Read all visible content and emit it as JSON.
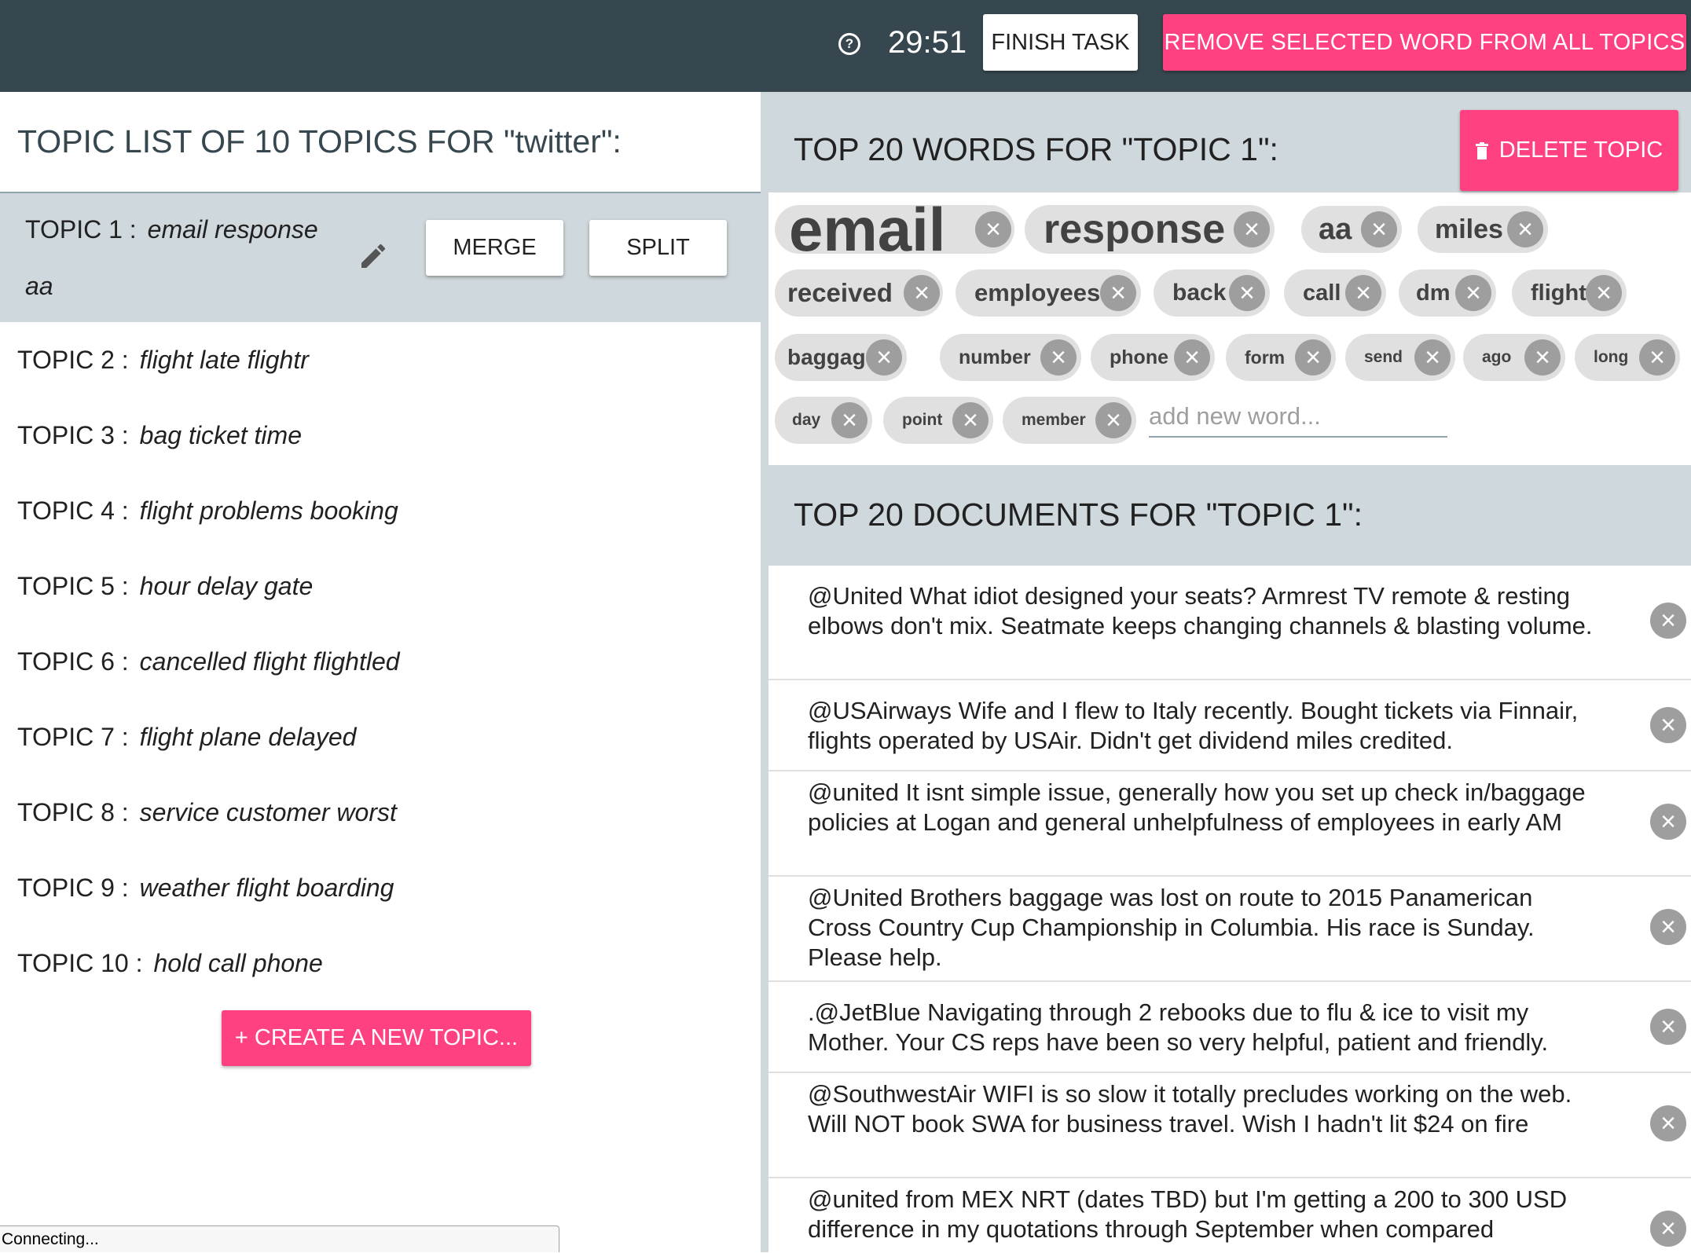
{
  "topbar": {
    "timer": "29:51",
    "finish_label": "FINISH TASK",
    "remove_label": "REMOVE SELECTED WORD FROM ALL TOPICS",
    "help_glyph": "?"
  },
  "topic_list": {
    "title": "TOPIC LIST OF 10 TOPICS FOR \"twitter\":",
    "topics": [
      {
        "label": "TOPIC 1 :",
        "words": "email response",
        "words2": "aa"
      },
      {
        "label": "TOPIC 2 :",
        "words": "flight late flightr"
      },
      {
        "label": "TOPIC 3 :",
        "words": "bag ticket time"
      },
      {
        "label": "TOPIC 4 :",
        "words": "flight problems booking"
      },
      {
        "label": "TOPIC 5 :",
        "words": "hour delay gate"
      },
      {
        "label": "TOPIC 6 :",
        "words": "cancelled flight flightled"
      },
      {
        "label": "TOPIC 7 :",
        "words": "flight plane delayed"
      },
      {
        "label": "TOPIC 8 :",
        "words": "service customer worst"
      },
      {
        "label": "TOPIC 9 :",
        "words": "weather flight boarding"
      },
      {
        "label": "TOPIC 10 :",
        "words": "hold call phone"
      }
    ],
    "merge_label": "MERGE",
    "split_label": "SPLIT",
    "create_label": "+ CREATE A NEW TOPIC..."
  },
  "words_panel": {
    "title": "TOP 20 WORDS FOR \"TOPIC 1\":",
    "delete_label": "DELETE TOPIC",
    "words": [
      "email",
      "response",
      "aa",
      "miles",
      "received",
      "employees",
      "back",
      "call",
      "dm",
      "flight",
      "baggage",
      "number",
      "phone",
      "form",
      "send",
      "ago",
      "long",
      "day",
      "point",
      "member"
    ],
    "new_word_placeholder": "add new word..."
  },
  "docs_panel": {
    "title": "TOP 20 DOCUMENTS FOR \"TOPIC 1\":",
    "docs": [
      "@United What idiot designed your seats? Armrest TV remote & resting elbows don't mix. Seatmate keeps changing channels & blasting volume.",
      "@USAirways Wife and I flew to Italy recently. Bought tickets via Finnair, flights operated by USAir. Didn't get dividend miles credited.",
      "@united It isnt simple issue, generally how you set up check in/baggage policies at Logan and general unhelpfulness of employees in early AM",
      "@United Brothers baggage was lost on route to 2015 Panamerican Cross Country Cup Championship in Columbia. His race is Sunday. Please help.",
      ".@JetBlue Navigating through 2 rebooks due to flu & ice to visit my Mother. Your CS reps have been so very helpful, patient and friendly.",
      "@SouthwestAir WIFI is so slow it totally precludes working on the web. Will NOT book SWA for business travel. Wish I hadn't lit $24 on fire",
      "@united from MEX NRT (dates TBD) but I'm getting a 200 to 300 USD difference in my quotations through September when compared"
    ]
  },
  "status": "Connecting...",
  "colors": {
    "topbar": "#37474f",
    "accent": "#ff4081",
    "panel": "#cfd8dc",
    "chip": "#e0e0e0"
  },
  "icons": {
    "help": "help-circle-icon",
    "edit": "pencil-icon",
    "delete": "trash-icon",
    "remove": "close-circle-icon"
  }
}
